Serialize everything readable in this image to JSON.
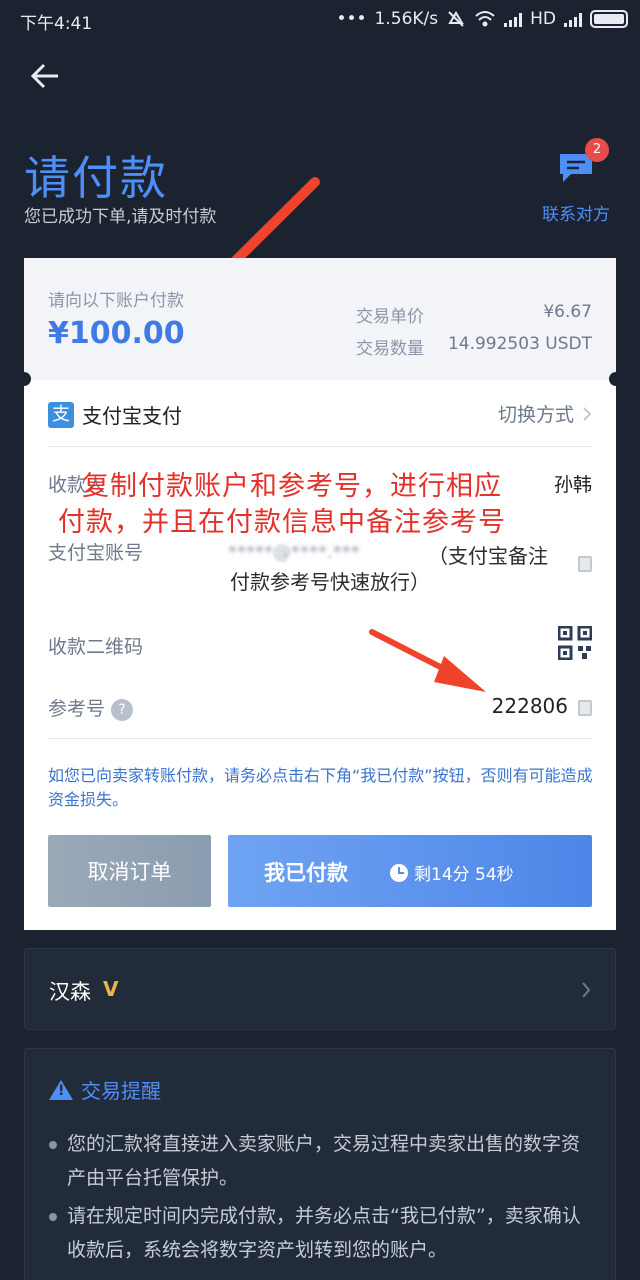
{
  "status_bar": {
    "time": "下午4:41",
    "net_speed": "1.56K/s",
    "network": "HD"
  },
  "header": {
    "title": "请付款",
    "subtitle": "您已成功下单,请及时付款",
    "contact_label": "联系对方",
    "contact_badge": "2"
  },
  "order": {
    "pay_to_label": "请向以下账户付款",
    "amount": "¥100.00",
    "unit_price_label": "交易单价",
    "unit_price": "¥6.67",
    "quantity_label": "交易数量",
    "quantity": "14.992503 USDT"
  },
  "payment": {
    "method_icon": "支",
    "method_name": "支付宝支付",
    "switch_label": "切换方式",
    "payee_label": "收款人",
    "payee_value": "孙韩",
    "account_label": "支付宝账号",
    "account_value": "*****@****.***",
    "qr_label": "收款二维码",
    "ref_label": "参考号",
    "ref_value": "222806"
  },
  "annotations": {
    "red_line1": "复制付款账户和参考号，进行相应",
    "red_line2": "付款，并且在付款信息中备注参考号",
    "dark_line1": "（支付宝备注",
    "dark_line2": "付款参考号快速放行）"
  },
  "notice": "如您已向卖家转账付款，请务必点击右下角“我已付款”按钮，否则有可能造成资金损失。",
  "buttons": {
    "cancel": "取消订单",
    "paid": "我已付款",
    "timer": "剩14分 54秒"
  },
  "seller": {
    "name": "汉森",
    "badge": "V"
  },
  "tips": {
    "title": "交易提醒",
    "items": [
      "您的汇款将直接进入卖家账户，交易过程中卖家出售的数字资产由平台托管保护。",
      "请在规定时间内完成付款，并务必点击“我已付款”，卖家确认收款后，系统会将数字资产划转到您的账户。"
    ]
  },
  "colors": {
    "background": "#1b2330",
    "accent": "#4e8ef7",
    "annotation_red": "#e3322b"
  }
}
